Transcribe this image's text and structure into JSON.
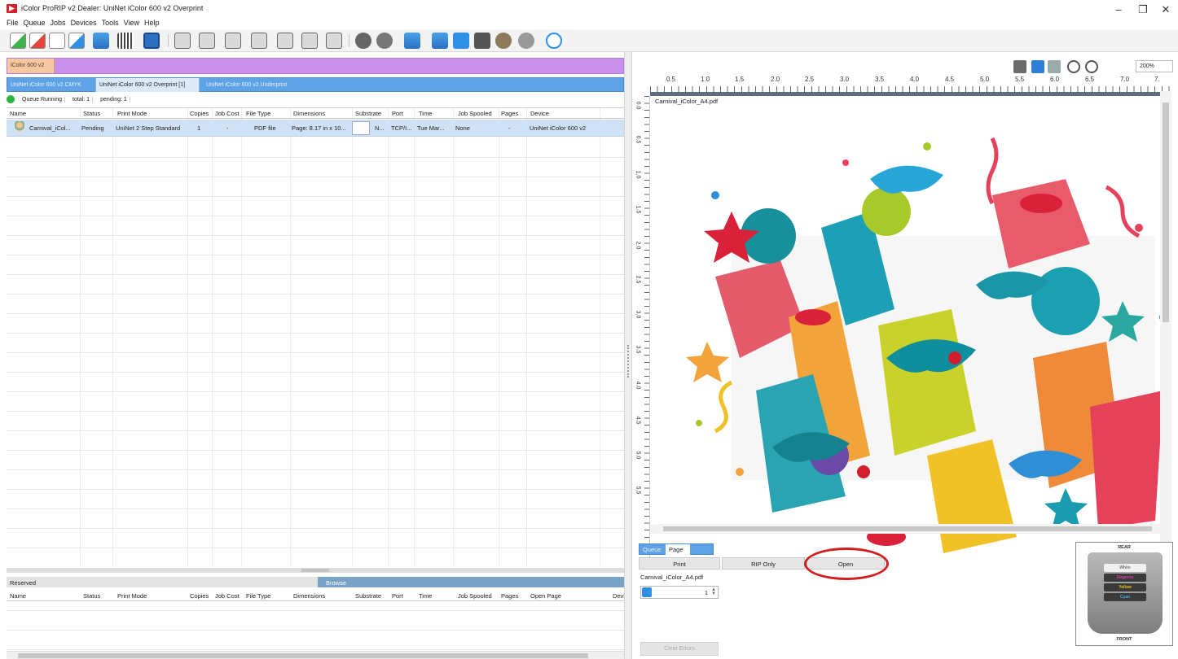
{
  "window": {
    "title": "iColor ProRIP v2 Dealer: UniNet iColor 600 v2 Overprint",
    "controls": [
      "–",
      "❐",
      "✕"
    ]
  },
  "menu": [
    "File",
    "Queue",
    "Jobs",
    "Devices",
    "Tools",
    "View",
    "Help"
  ],
  "device_tab": "iColor 600 v2",
  "queue_tabs": [
    {
      "label": "UniNet iColor 600 v2 CMYK",
      "active": false
    },
    {
      "label": "UniNet iColor 600 v2 Overprint [1]",
      "active": true
    },
    {
      "label": "UniNet iColor 600 v2 Underprint",
      "active": false
    }
  ],
  "queue_status": {
    "running": "Queue Running",
    "total": "total: 1",
    "pending": "pending: 1"
  },
  "job_columns": [
    "Name",
    "Status",
    "Print Mode",
    "Copies",
    "Job Cost",
    "File Type",
    "Dimensions",
    "Substrate",
    "Port",
    "Time",
    "Job Spooled",
    "Pages",
    "Device"
  ],
  "job_rows": [
    {
      "name": "Carnival_iCol...",
      "status": "Pending",
      "print_mode": "UniNet 2 Step Standard",
      "copies": "1",
      "job_cost": "-",
      "file_type": "PDF file",
      "dimensions": "Page: 8.17 in x 10...",
      "substrate": "N...",
      "port": "TCP/I...",
      "time": "Tue Mar...",
      "job_spooled": "None",
      "pages": "-",
      "device": "UniNet iColor 600 v2"
    }
  ],
  "lower": {
    "reserved_label": "Reserved",
    "browse_label": "Browse",
    "columns": [
      "Name",
      "Status",
      "Print Mode",
      "Copies",
      "Job Cost",
      "File Type",
      "Dimensions",
      "Substrate",
      "Port",
      "Time",
      "Job Spooled",
      "Pages",
      "Open Page",
      "Device"
    ]
  },
  "preview": {
    "zoom": "200%",
    "ruler_top": [
      "0.5",
      "1.0",
      "1.5",
      "2.0",
      "2.5",
      "3.0",
      "3.5",
      "4.0",
      "4.5",
      "5.0",
      "5.5",
      "6.0",
      "6.5",
      "7.0",
      "7."
    ],
    "ruler_left": [
      "0.0",
      "0.5",
      "1.0",
      "1.5",
      "2.0",
      "2.5",
      "3.0",
      "3.5",
      "4.0",
      "4.5",
      "5.0",
      "5.5"
    ],
    "file_name": "Carnival_iColor_A4.pdf"
  },
  "print_panel": {
    "tabs": [
      {
        "label": "Queue",
        "active": false
      },
      {
        "label": "Page",
        "active": true
      }
    ],
    "print_label": "Print",
    "rip_only_label": "RIP Only",
    "open_label": "Open",
    "file_name": "Carnival_iColor_A4.pdf",
    "page_number": "1",
    "clear_errors_label": "Clear Errors"
  },
  "platen": {
    "rear_label": "REAR",
    "front_label": "FRONT",
    "slots": [
      {
        "label": "White",
        "color": "#f0f0f0"
      },
      {
        "label": "Magenta",
        "color": "#d63ba5"
      },
      {
        "label": "Yellow",
        "color": "#e6c21a"
      },
      {
        "label": "Cyan",
        "color": "#4aa8d8"
      }
    ]
  },
  "colors": {
    "device_bar": "#c890ea",
    "queue_bar": "#5ea3e6",
    "selected_row": "#cfe1f4",
    "running_dot": "#29b53c",
    "highlight_ellipse": "#d21e1e"
  }
}
